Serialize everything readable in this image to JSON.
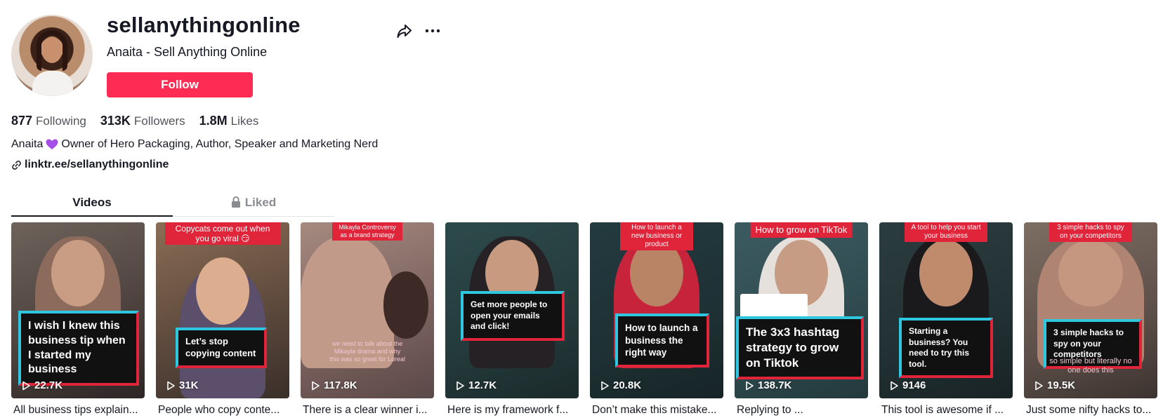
{
  "profile": {
    "username": "sellanythingonline",
    "nickname": "Anaita - Sell Anything Online",
    "follow_label": "Follow",
    "bio": "Owner of Hero Packaging, Author, Speaker and Marketing Nerd",
    "bio_prefix": "Anaita",
    "link": "linktr.ee/sellanythingonline",
    "icons": [
      "share-icon",
      "more-icon",
      "purple-heart-icon",
      "link-icon",
      "lock-icon",
      "play-icon"
    ]
  },
  "stats": {
    "following_num": "877",
    "following_lbl": "Following",
    "followers_num": "313K",
    "followers_lbl": "Followers",
    "likes_num": "1.8M",
    "likes_lbl": "Likes"
  },
  "tabs": {
    "videos": "Videos",
    "liked": "Liked"
  },
  "colors": {
    "accent": "#fe2c55",
    "caption_cyan": "#2fc7df",
    "caption_red": "#e0243a"
  },
  "videos": [
    {
      "views": "22.7K",
      "desc": "All business tips explain...",
      "caption": "I wish I knew this business tip when I started my business",
      "tag": ""
    },
    {
      "views": "31K",
      "desc": "People who copy conte...",
      "caption": "Let’s stop copying content",
      "tag": "Copycats come out when you go viral 😏"
    },
    {
      "views": "117.8K",
      "desc": "There is a clear winner i...",
      "caption": "",
      "tag": "Mikayla Controversy as a brand strategy",
      "overlay": "we need to talk about the Mikayla drama and why this was so great for Loreal"
    },
    {
      "views": "12.7K",
      "desc": "Here is my framework f...",
      "caption": "Get more people to open your emails and click!",
      "tag": ""
    },
    {
      "views": "20.8K",
      "desc": "Don’t make this mistake...",
      "caption": "How to launch a business the right way",
      "tag": "How to launch a new business or product"
    },
    {
      "views": "138.7K",
      "desc": "Replying to ...",
      "caption": "The 3x3 hashtag strategy to grow on Tiktok",
      "tag": "How to grow on TikTok"
    },
    {
      "views": "9146",
      "desc": "This tool is awesome if ...",
      "caption": "Starting a business? You need to try this tool.",
      "tag": "A tool to help you start your business"
    },
    {
      "views": "19.5K",
      "desc": "Just some nifty hacks to...",
      "caption": "3 simple hacks to spy on your competitors",
      "tag": "3 simple hacks to spy on your competitors",
      "overlay": "so simple but literally no one does this"
    }
  ]
}
